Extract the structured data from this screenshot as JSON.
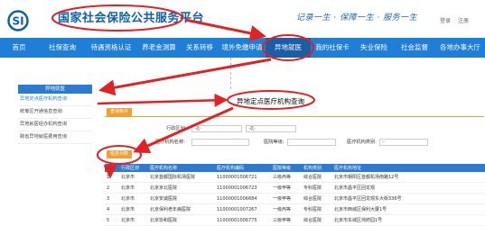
{
  "header": {
    "site_title": "国家社会保险公共服务平台",
    "slogan": "记录一生 · 保障一生 · 服务一生",
    "login": "登录",
    "register": "注册"
  },
  "nav": {
    "items": [
      {
        "label": "首页"
      },
      {
        "label": "社保查询"
      },
      {
        "label": "待遇资格认证"
      },
      {
        "label": "养老金测算"
      },
      {
        "label": "关系转移"
      },
      {
        "label": "境外免缴申请"
      },
      {
        "label": "异地就医"
      },
      {
        "label": "我的社保卡"
      },
      {
        "label": "失业保险"
      },
      {
        "label": "社会监督"
      },
      {
        "label": "各地办事大厅"
      }
    ]
  },
  "sidebar": {
    "title": "异地就医",
    "items": [
      {
        "label": "异地定点医疗机构查询"
      },
      {
        "label": "统筹区开通信息查询"
      },
      {
        "label": "异地就医经办机构查询"
      },
      {
        "label": "跨省异地就医费用查询"
      }
    ]
  },
  "main": {
    "section_title": "异地定点医疗机构查询",
    "query_tag": "查询条件",
    "fields": {
      "region_label": "行政区划:",
      "region_value_1": "-选-",
      "region_value_2": "-选-",
      "institution_name_label": "医疗机构名称:",
      "level_label": "医院等级:",
      "type_label": "医疗机构类别:",
      "type_value": "--"
    },
    "result_tag": "信息列表",
    "table": {
      "headers": [
        "序号",
        "行政区划",
        "医疗机构名称",
        "医疗机构编码",
        "医院等级",
        "机构类别",
        "医疗机构地址"
      ],
      "rows": [
        [
          "1",
          "北京市",
          "北京首都国际机场医院",
          "11000001006721",
          "三级丙等",
          "综合医院",
          "北京市朝阳区首都机场南路12号"
        ],
        [
          "2",
          "北京市",
          "北京京北医院",
          "11000001006723",
          "一级甲等",
          "专科医院",
          "北京市昌平区回龙观"
        ],
        [
          "3",
          "北京市",
          "北京安诚医院",
          "11000001006684",
          "一级甲等",
          "综合医院",
          "北京市昌平区回龙观东大街336号"
        ],
        [
          "4",
          "北京市",
          "北京保利老年病医院",
          "11000001007267",
          "一级丙等",
          "专科医院",
          "北京市西城区保利大厦1号"
        ],
        [
          "5",
          "北京市",
          "北京协和医院",
          "11000001006775",
          "三级甲等",
          "综合医院",
          "北京市东城区帅府园1号"
        ]
      ]
    }
  },
  "colors": {
    "brand_blue": "#0f5fae",
    "nav_blue": "#1f7ed6",
    "tag_orange": "#f0a030",
    "annotation_red": "#e22222"
  }
}
